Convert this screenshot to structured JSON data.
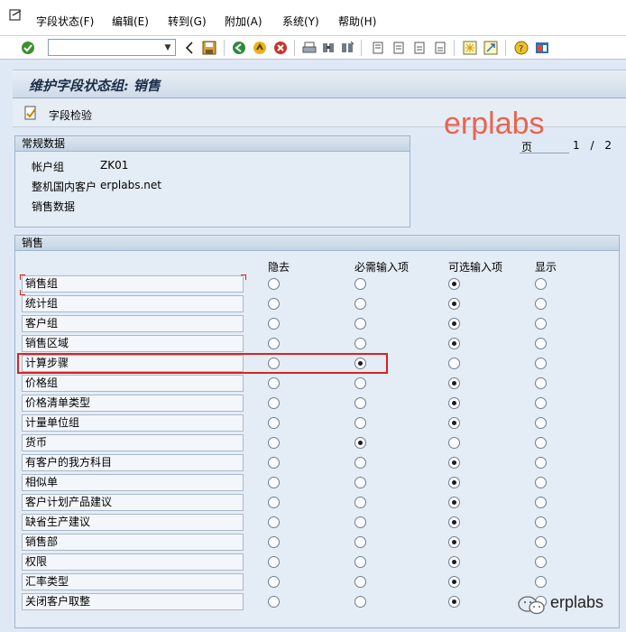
{
  "menu": {
    "items": [
      "字段状态(F)",
      "编辑(E)",
      "转到(G)",
      "附加(A)",
      "系统(Y)",
      "帮助(H)"
    ]
  },
  "toolbar": {
    "command_value": ""
  },
  "title": "维护字段状态组: 销售",
  "app_toolbar": {
    "field_check_label": "字段检验"
  },
  "watermark": "erplabs",
  "pager": {
    "label": "页",
    "current": "1",
    "separator": "/",
    "total": "2"
  },
  "general": {
    "title": "常规数据",
    "account_group_label": "帐户组",
    "account_group_value": "ZK01",
    "customer_label": "整机国内客户",
    "customer_value": "erplabs.net",
    "sales_data_label": "销售数据"
  },
  "sales": {
    "title": "销售",
    "columns": [
      "隐去",
      "必需输入项",
      "可选输入项",
      "显示"
    ],
    "rows": [
      {
        "label": "销售组",
        "selected": 2
      },
      {
        "label": "统计组",
        "selected": 2
      },
      {
        "label": "客户组",
        "selected": 2
      },
      {
        "label": "销售区域",
        "selected": 2
      },
      {
        "label": "计算步骤",
        "selected": 1
      },
      {
        "label": "价格组",
        "selected": 2
      },
      {
        "label": "价格清单类型",
        "selected": 2
      },
      {
        "label": "计量单位组",
        "selected": 2
      },
      {
        "label": "货币",
        "selected": 1
      },
      {
        "label": "有客户的我方科目",
        "selected": 2
      },
      {
        "label": "相似单",
        "selected": 2
      },
      {
        "label": "客户计划产品建议",
        "selected": 2
      },
      {
        "label": "缺省生产建议",
        "selected": 2
      },
      {
        "label": "销售部",
        "selected": 2
      },
      {
        "label": "权限",
        "selected": 2
      },
      {
        "label": "汇率类型",
        "selected": 2
      },
      {
        "label": "关闭客户取整",
        "selected": 2
      }
    ]
  },
  "footer_brand": "erplabs",
  "colors": {
    "highlight": "#d9231f",
    "watermark": "#e8654f"
  }
}
